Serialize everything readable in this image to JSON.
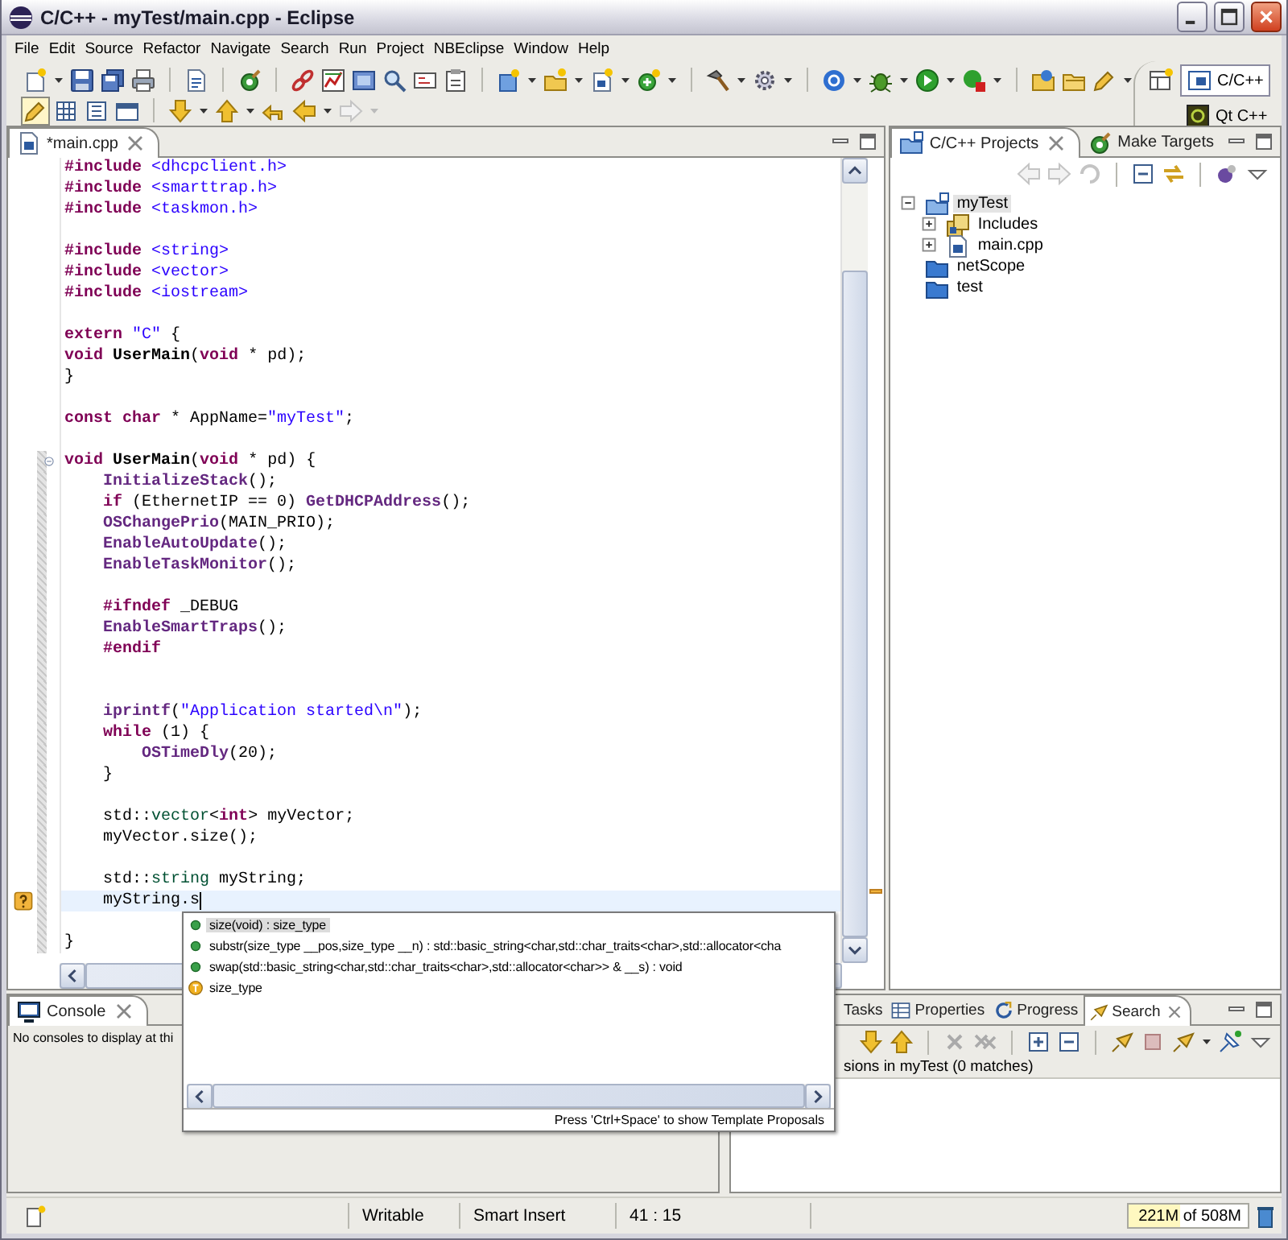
{
  "window": {
    "title": "C/C++ - myTest/main.cpp - Eclipse"
  },
  "menu": [
    "File",
    "Edit",
    "Source",
    "Refactor",
    "Navigate",
    "Search",
    "Run",
    "Project",
    "NBEclipse",
    "Window",
    "Help"
  ],
  "toolbar": {
    "highlight_toggle": {
      "pressed": true
    },
    "forward_button": {
      "disabled": true
    }
  },
  "perspectives": [
    {
      "label": "C/C++",
      "selected": true
    },
    {
      "label": "Qt C++",
      "selected": false
    }
  ],
  "editor": {
    "tabs": [
      {
        "label": "*main.cpp",
        "selected": true
      }
    ],
    "lines": [
      {
        "tokens": [
          {
            "kind": "keyword",
            "text": "#include"
          },
          {
            "kind": "string",
            "text": " <dhcpclient.h>"
          }
        ],
        "changed": false,
        "fold": false,
        "current": false,
        "warning": false
      },
      {
        "tokens": [
          {
            "kind": "keyword",
            "text": "#include"
          },
          {
            "kind": "string",
            "text": " <smarttrap.h>"
          }
        ],
        "changed": false,
        "fold": false,
        "current": false,
        "warning": false
      },
      {
        "tokens": [
          {
            "kind": "keyword",
            "text": "#include"
          },
          {
            "kind": "string",
            "text": " <taskmon.h>"
          }
        ],
        "changed": false,
        "fold": false,
        "current": false,
        "warning": false
      },
      {
        "changed": false,
        "fold": false,
        "current": false,
        "warning": false
      },
      {
        "tokens": [
          {
            "kind": "keyword",
            "text": "#include"
          },
          {
            "kind": "string",
            "text": " <string>"
          }
        ],
        "changed": false,
        "fold": false,
        "current": false,
        "warning": false
      },
      {
        "tokens": [
          {
            "kind": "keyword",
            "text": "#include"
          },
          {
            "kind": "string",
            "text": " <vector>"
          }
        ],
        "changed": false,
        "fold": false,
        "current": false,
        "warning": false
      },
      {
        "tokens": [
          {
            "kind": "keyword",
            "text": "#include"
          },
          {
            "kind": "string",
            "text": " <iostream>"
          }
        ],
        "changed": false,
        "fold": false,
        "current": false,
        "warning": false
      },
      {
        "changed": false,
        "fold": false,
        "current": false,
        "warning": false
      },
      {
        "tokens": [
          {
            "kind": "keyword",
            "text": "extern"
          },
          {
            "kind": "string",
            "text": " \"C\""
          },
          {
            "kind": "plain",
            "text": " {"
          }
        ],
        "changed": false,
        "fold": false,
        "current": false,
        "warning": false
      },
      {
        "tokens": [
          {
            "kind": "keyword",
            "text": "void"
          },
          {
            "kind": "declaration",
            "text": " UserMain"
          },
          {
            "kind": "plain",
            "text": "("
          },
          {
            "kind": "keyword",
            "text": "void"
          },
          {
            "kind": "plain",
            "text": " * pd);"
          }
        ],
        "changed": false,
        "fold": false,
        "current": false,
        "warning": false
      },
      {
        "tokens": [
          {
            "kind": "plain",
            "text": "}"
          }
        ],
        "changed": false,
        "fold": false,
        "current": false,
        "warning": false
      },
      {
        "changed": false,
        "fold": false,
        "current": false,
        "warning": false
      },
      {
        "tokens": [
          {
            "kind": "keyword",
            "text": "const char"
          },
          {
            "kind": "plain",
            "text": " * AppName="
          },
          {
            "kind": "string",
            "text": "\"myTest\""
          },
          {
            "kind": "plain",
            "text": ";"
          }
        ],
        "changed": false,
        "fold": false,
        "current": false,
        "warning": false
      },
      {
        "changed": false,
        "fold": false,
        "current": false,
        "warning": false
      },
      {
        "tokens": [
          {
            "kind": "keyword",
            "text": "void"
          },
          {
            "kind": "declaration",
            "text": " UserMain"
          },
          {
            "kind": "plain",
            "text": "("
          },
          {
            "kind": "keyword",
            "text": "void"
          },
          {
            "kind": "plain",
            "text": " * pd) {"
          }
        ],
        "changed": true,
        "fold": true,
        "current": false,
        "warning": false
      },
      {
        "tokens": [
          {
            "kind": "function",
            "text": "    InitializeStack"
          },
          {
            "kind": "plain",
            "text": "();"
          }
        ],
        "changed": true,
        "fold": false,
        "current": false,
        "warning": false
      },
      {
        "tokens": [
          {
            "kind": "keyword",
            "text": "    if"
          },
          {
            "kind": "plain",
            "text": " (EthernetIP == 0) "
          },
          {
            "kind": "function",
            "text": "GetDHCPAddress"
          },
          {
            "kind": "plain",
            "text": "();"
          }
        ],
        "changed": true,
        "fold": false,
        "current": false,
        "warning": false
      },
      {
        "tokens": [
          {
            "kind": "function",
            "text": "    OSChangePrio"
          },
          {
            "kind": "plain",
            "text": "(MAIN_PRIO);"
          }
        ],
        "changed": true,
        "fold": false,
        "current": false,
        "warning": false
      },
      {
        "tokens": [
          {
            "kind": "function",
            "text": "    EnableAutoUpdate"
          },
          {
            "kind": "plain",
            "text": "();"
          }
        ],
        "changed": true,
        "fold": false,
        "current": false,
        "warning": false
      },
      {
        "tokens": [
          {
            "kind": "function",
            "text": "    EnableTaskMonitor"
          },
          {
            "kind": "plain",
            "text": "();"
          }
        ],
        "changed": true,
        "fold": false,
        "current": false,
        "warning": false
      },
      {
        "changed": true,
        "fold": false,
        "current": false,
        "warning": false
      },
      {
        "tokens": [
          {
            "kind": "keyword",
            "text": "    #ifndef"
          },
          {
            "kind": "plain",
            "text": " _DEBUG"
          }
        ],
        "changed": true,
        "fold": false,
        "current": false,
        "warning": false
      },
      {
        "tokens": [
          {
            "kind": "function",
            "text": "    EnableSmartTraps"
          },
          {
            "kind": "plain",
            "text": "();"
          }
        ],
        "changed": true,
        "fold": false,
        "current": false,
        "warning": false
      },
      {
        "tokens": [
          {
            "kind": "keyword",
            "text": "    #endif"
          }
        ],
        "changed": true,
        "fold": false,
        "current": false,
        "warning": false
      },
      {
        "changed": true,
        "fold": false,
        "current": false,
        "warning": false
      },
      {
        "changed": true,
        "fold": false,
        "current": false,
        "warning": false
      },
      {
        "tokens": [
          {
            "kind": "function",
            "text": "    iprintf"
          },
          {
            "kind": "plain",
            "text": "("
          },
          {
            "kind": "string",
            "text": "\"Application started\\n\""
          },
          {
            "kind": "plain",
            "text": ");"
          }
        ],
        "changed": true,
        "fold": false,
        "current": false,
        "warning": false
      },
      {
        "tokens": [
          {
            "kind": "keyword",
            "text": "    while"
          },
          {
            "kind": "plain",
            "text": " (1) {"
          }
        ],
        "changed": true,
        "fold": false,
        "current": false,
        "warning": false
      },
      {
        "tokens": [
          {
            "kind": "function",
            "text": "        OSTimeDly"
          },
          {
            "kind": "plain",
            "text": "(20);"
          }
        ],
        "changed": true,
        "fold": false,
        "current": false,
        "warning": false
      },
      {
        "tokens": [
          {
            "kind": "plain",
            "text": "    }"
          }
        ],
        "changed": true,
        "fold": false,
        "current": false,
        "warning": false
      },
      {
        "changed": true,
        "fold": false,
        "current": false,
        "warning": false
      },
      {
        "tokens": [
          {
            "kind": "plain",
            "text": "    std::"
          },
          {
            "kind": "type",
            "text": "vector"
          },
          {
            "kind": "plain",
            "text": "<"
          },
          {
            "kind": "keyword",
            "text": "int"
          },
          {
            "kind": "plain",
            "text": "> myVector;"
          }
        ],
        "changed": true,
        "fold": false,
        "current": false,
        "warning": false
      },
      {
        "tokens": [
          {
            "kind": "plain",
            "text": "    myVector.size();"
          }
        ],
        "changed": true,
        "fold": false,
        "current": false,
        "warning": false
      },
      {
        "changed": true,
        "fold": false,
        "current": false,
        "warning": false
      },
      {
        "tokens": [
          {
            "kind": "plain",
            "text": "    std::"
          },
          {
            "kind": "type",
            "text": "string"
          },
          {
            "kind": "plain",
            "text": " myString;"
          }
        ],
        "changed": true,
        "fold": false,
        "current": false,
        "warning": false
      },
      {
        "tokens": [
          {
            "kind": "plain",
            "text": "    myString.s"
          }
        ],
        "changed": true,
        "fold": false,
        "current": true,
        "warning": true
      },
      {
        "changed": true,
        "fold": false,
        "current": false,
        "warning": false
      },
      {
        "tokens": [
          {
            "kind": "plain",
            "text": "}"
          }
        ],
        "changed": true,
        "fold": false,
        "current": false,
        "warning": false
      }
    ]
  },
  "completion_popup": {
    "items": [
      {
        "kind": "method",
        "text": "size(void) : size_type",
        "selected": true
      },
      {
        "kind": "method",
        "text": "substr(size_type __pos,size_type __n) : std::basic_string<char,std::char_traits<char>,std::allocator<cha",
        "selected": false
      },
      {
        "kind": "method",
        "text": "swap(std::basic_string<char,std::char_traits<char>,std::allocator<char>> & __s) : void",
        "selected": false
      },
      {
        "kind": "type",
        "text": "size_type",
        "selected": false
      }
    ],
    "footer": "Press 'Ctrl+Space' to show Template Proposals"
  },
  "projects_view": {
    "tabs": [
      {
        "label": "C/C++ Projects",
        "selected": true
      },
      {
        "label": "Make Targets",
        "selected": false
      }
    ],
    "tree": [
      {
        "label": "myTest",
        "kind": "project",
        "expanded": true,
        "selected": true,
        "children": [
          {
            "label": "Includes",
            "kind": "includes",
            "expanded": false,
            "selected": false
          },
          {
            "label": "main.cpp",
            "kind": "file",
            "expanded": false,
            "selected": false
          }
        ]
      },
      {
        "label": "netScope",
        "kind": "folder",
        "selected": false
      },
      {
        "label": "test",
        "kind": "folder",
        "selected": false
      }
    ]
  },
  "console_view": {
    "tabs": [
      {
        "label": "Console",
        "selected": true
      }
    ],
    "message": "No consoles to display at thi"
  },
  "search_view": {
    "tabs": [
      {
        "label": "Tasks",
        "selected": false
      },
      {
        "label": "Properties",
        "selected": false
      },
      {
        "label": "Progress",
        "selected": false
      },
      {
        "label": "Search",
        "selected": true
      }
    ],
    "summary": "sions in myTest (0 matches)"
  },
  "status_bar": {
    "mode": "Writable",
    "insert_mode": "Smart Insert",
    "position": "41 : 15",
    "heap": {
      "text": "221M of 508M",
      "level": 0.435
    }
  }
}
